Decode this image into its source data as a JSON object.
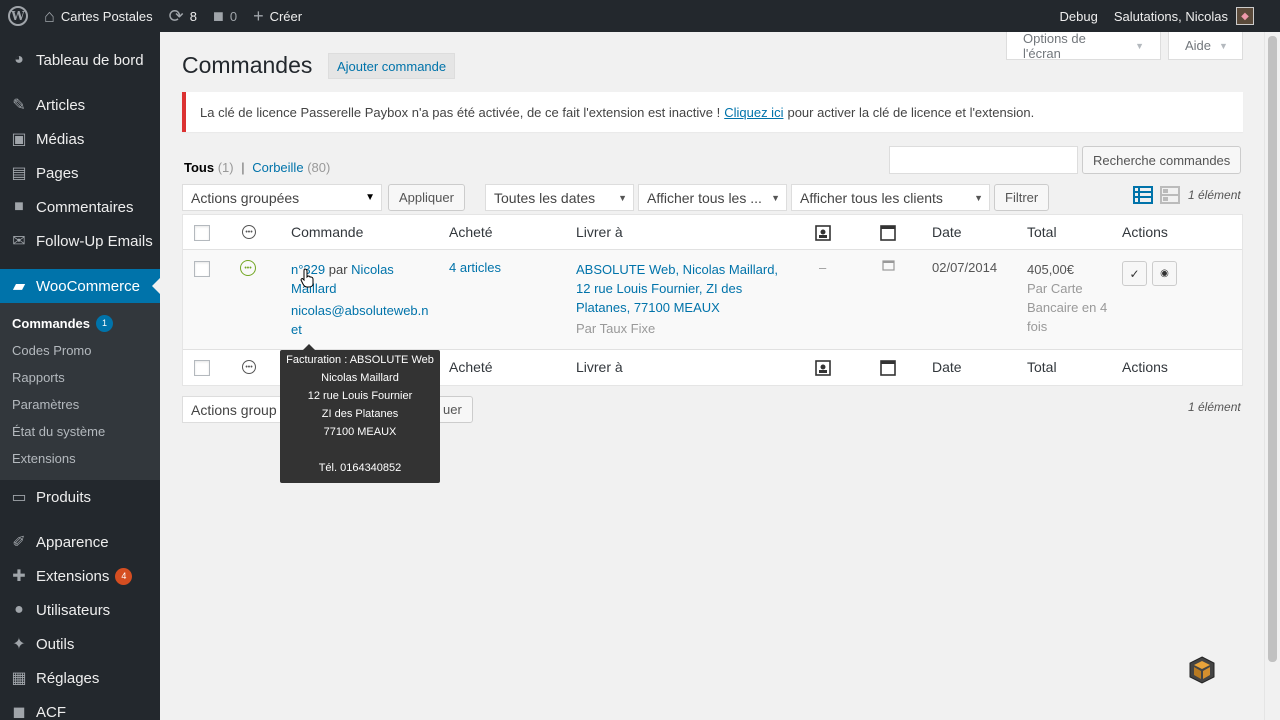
{
  "colors": {
    "adminbar": "#23282d",
    "accent": "#0073aa",
    "notice_error": "#dc3232",
    "status_pending": "#73a724",
    "badge_red": "#d54e21"
  },
  "adminbar": {
    "site_name": "Cartes Postales",
    "updates_count": "8",
    "comments_count": "0",
    "new_label": "Créer",
    "debug_label": "Debug",
    "greeting": "Salutations, Nicolas"
  },
  "sidebar": {
    "items": [
      {
        "label": "Tableau de bord",
        "icon": "dashboard-icon"
      },
      {
        "label": "Articles",
        "icon": "pin-icon"
      },
      {
        "label": "Médias",
        "icon": "media-icon"
      },
      {
        "label": "Pages",
        "icon": "pages-icon"
      },
      {
        "label": "Commentaires",
        "icon": "comments-icon"
      },
      {
        "label": "Follow-Up Emails",
        "icon": "email-icon"
      },
      {
        "label": "WooCommerce",
        "icon": "woo-icon"
      },
      {
        "label": "Produits",
        "icon": "products-icon"
      },
      {
        "label": "Apparence",
        "icon": "brush-icon"
      },
      {
        "label": "Extensions",
        "icon": "plugin-icon",
        "badge": "4"
      },
      {
        "label": "Utilisateurs",
        "icon": "users-icon"
      },
      {
        "label": "Outils",
        "icon": "tools-icon"
      },
      {
        "label": "Réglages",
        "icon": "settings-icon"
      },
      {
        "label": "ACF",
        "icon": "acf-icon"
      }
    ],
    "woo_submenu": [
      {
        "label": "Commandes",
        "badge": "1"
      },
      {
        "label": "Codes Promo"
      },
      {
        "label": "Rapports"
      },
      {
        "label": "Paramètres"
      },
      {
        "label": "État du système"
      },
      {
        "label": "Extensions"
      }
    ]
  },
  "header": {
    "screen_options": "Options de l'écran",
    "help": "Aide",
    "title": "Commandes",
    "add_new": "Ajouter commande"
  },
  "notice": {
    "text_before": "La clé de licence Passerelle Paybox n'a pas été activée, de ce fait l'extension est inactive !",
    "link": "Cliquez ici",
    "text_after": "pour activer la clé de licence et l'extension."
  },
  "filters": {
    "all_label": "Tous",
    "all_count": "(1)",
    "separator": "|",
    "trash_label": "Corbeille",
    "trash_count": "(80)",
    "search_button": "Recherche commandes",
    "bulk_actions": "Actions groupées",
    "apply": "Appliquer",
    "dates": "Toutes les dates",
    "types": "Afficher tous les ...",
    "clients": "Afficher tous les clients",
    "filter": "Filtrer",
    "item_count": "1 élément"
  },
  "table": {
    "columns": {
      "order": "Commande",
      "bought": "Acheté",
      "ship_to": "Livrer à",
      "date": "Date",
      "total": "Total",
      "actions": "Actions"
    },
    "rows": [
      {
        "order_link": "n°329",
        "order_by": "par",
        "customer": "Nicolas Maillard",
        "email": "nicolas@absoluteweb.net",
        "items": "4 articles",
        "address": "ABSOLUTE Web, Nicolas Maillard, 12 rue Louis Fournier, ZI des Platanes, 77100 MEAUX",
        "shipping_method": "Par Taux Fixe",
        "note": "–",
        "date": "02/07/2014",
        "total": "405,00€",
        "payment": "Par Carte Bancaire en 4 fois"
      }
    ]
  },
  "bottom": {
    "bulk_actions_partial": "Actions group",
    "apply_partial": "uer",
    "item_count": "1 élément"
  },
  "tooltip": {
    "line1": "Facturation : ABSOLUTE Web",
    "line2": "Nicolas Maillard",
    "line3": "12 rue Louis Fournier",
    "line4": "ZI des Platanes",
    "line5": "77100 MEAUX",
    "line6": "Tél. 0164340852"
  }
}
